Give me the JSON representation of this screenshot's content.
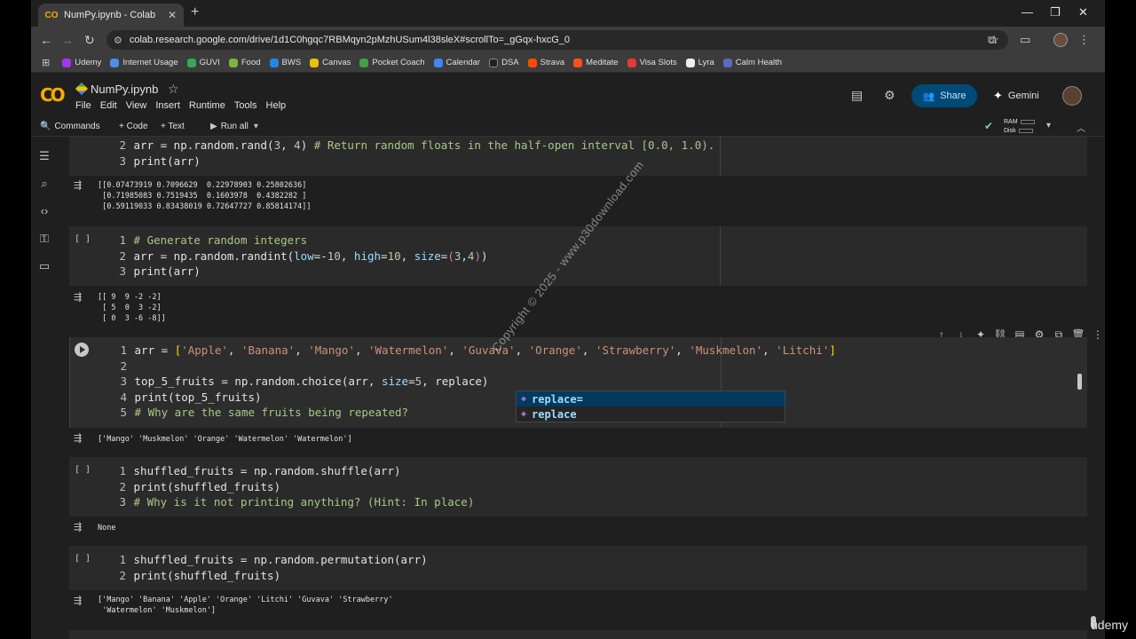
{
  "browser": {
    "tab_title": "NumPy.ipynb - Colab",
    "tab_icon_text": "CO",
    "url": "colab.research.google.com/drive/1d1C0hgqc7RBMqyn2pMzhUSum4l38sleX#scrollTo=_gGqx-hxcG_0",
    "bookmarks": [
      {
        "label": "Udemy",
        "color": "#a435f0"
      },
      {
        "label": "Internet Usage",
        "color": "#4a90e2"
      },
      {
        "label": "GUVI",
        "color": "#34a853"
      },
      {
        "label": "Food",
        "color": "#7cb342"
      },
      {
        "label": "BWS",
        "color": "#1e88e5"
      },
      {
        "label": "Canvas",
        "color": "#e6c200"
      },
      {
        "label": "Pocket Coach",
        "color": "#43a047"
      },
      {
        "label": "Calendar",
        "color": "#4285f4"
      },
      {
        "label": "DSA",
        "color": "#212121"
      },
      {
        "label": "Strava",
        "color": "#fc4c02"
      },
      {
        "label": "Meditate",
        "color": "#f4511e"
      },
      {
        "label": "Visa Slots",
        "color": "#e53935"
      },
      {
        "label": "Lyra",
        "color": "#eeeeee"
      },
      {
        "label": "Calm Health",
        "color": "#5c6bc0"
      }
    ]
  },
  "colab": {
    "title": "NumPy.ipynb",
    "menu": [
      "File",
      "Edit",
      "View",
      "Insert",
      "Runtime",
      "Tools",
      "Help"
    ],
    "share_label": "Share",
    "gemini_label": "Gemini",
    "toolbar": {
      "commands": "Commands",
      "code": "+ Code",
      "text": "+ Text",
      "run_all": "Run all",
      "ram": "RAM",
      "disk": "Disk"
    }
  },
  "cells": {
    "c1": {
      "lines": [
        "2",
        "3"
      ],
      "output": "[[0.07473919 0.7096629  0.22978903 0.25802636]\n [0.71985083 0.7519435  0.1603978  0.4382282 ]\n [0.59119033 0.83438019 0.72647727 0.85814174]]"
    },
    "c2": {
      "bracket": "[ ]",
      "output": "[[ 9  9 -2 -2]\n [ 5  0  3 -2]\n [ 0  3 -6 -8]]"
    },
    "c3": {
      "output": "['Mango' 'Muskmelon' 'Orange' 'Watermelon' 'Watermelon']"
    },
    "c4": {
      "bracket": "[ ]",
      "output": "None"
    },
    "c5": {
      "bracket": "[ ]",
      "output": "['Mango' 'Banana' 'Apple' 'Orange' 'Litchi' 'Guvava' 'Strawberry'\n 'Watermelon' 'Muskmelon']"
    }
  },
  "autocomplete": {
    "items": [
      "replace=",
      "replace"
    ]
  },
  "watermark": "Copyright © 2025 - www.p30download.com",
  "udemy_mark": "ûdemy"
}
